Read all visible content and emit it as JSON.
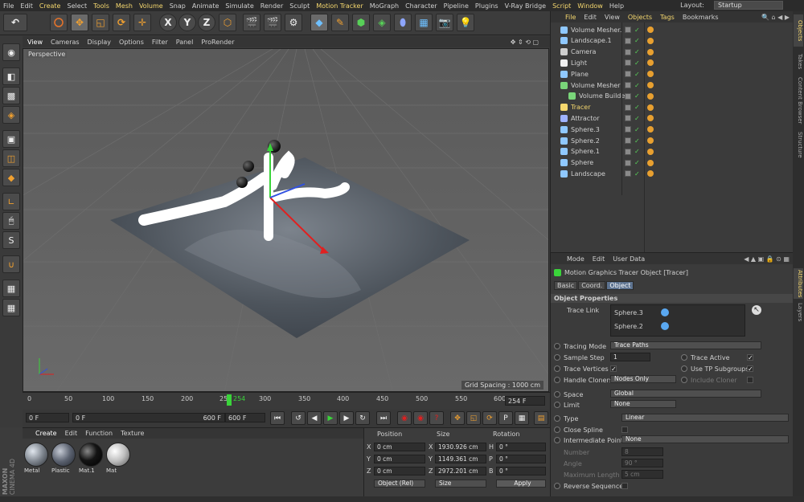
{
  "menu": {
    "items": [
      "File",
      "Edit",
      "Create",
      "Select",
      "Tools",
      "Mesh",
      "Volume",
      "Snap",
      "Animate",
      "Simulate",
      "Render",
      "Sculpt",
      "Motion Tracker",
      "MoGraph",
      "Character",
      "Pipeline",
      "Plugins",
      "V-Ray Bridge",
      "Script",
      "Window",
      "Help"
    ],
    "layout_label": "Layout:",
    "layout_value": "Startup"
  },
  "toolbar": {
    "axis_x": "X",
    "axis_y": "Y",
    "axis_z": "Z"
  },
  "viewport": {
    "menu": [
      "View",
      "Cameras",
      "Display",
      "Options",
      "Filter",
      "Panel",
      "ProRender"
    ],
    "camera_label": "Perspective",
    "grid_spacing": "Grid Spacing : 1000 cm"
  },
  "timeline": {
    "ticks": [
      "0",
      "50",
      "100",
      "150",
      "200",
      "25",
      "254",
      "300",
      "350",
      "400",
      "450",
      "500",
      "550",
      "600"
    ],
    "current_frame": "254",
    "end_frame_display": "254 F"
  },
  "transport": {
    "start": "0 F",
    "range_start": "0 F",
    "range_end": "600 F",
    "end": "600 F"
  },
  "materials": {
    "menu": [
      "Create",
      "Edit",
      "Function",
      "Texture"
    ],
    "items": [
      {
        "name": "Metal",
        "color": "#7f868f"
      },
      {
        "name": "Plastic",
        "color": "#5b6270"
      },
      {
        "name": "Mat.1",
        "color": "#141414"
      },
      {
        "name": "Mat",
        "color": "#bdbdbd"
      }
    ],
    "brand_top": "MAXON",
    "brand_bottom": "CINEMA 4D"
  },
  "coordinates": {
    "headers": [
      "Position",
      "Size",
      "Rotation"
    ],
    "rows": [
      {
        "axis": "X",
        "pos": "0 cm",
        "size": "1930.926 cm",
        "rot_label": "H",
        "rot": "0 °"
      },
      {
        "axis": "Y",
        "pos": "0 cm",
        "size": "1149.361 cm",
        "rot_label": "P",
        "rot": "0 °"
      },
      {
        "axis": "Z",
        "pos": "0 cm",
        "size": "2972.201 cm",
        "rot_label": "B",
        "rot": "0 °"
      }
    ],
    "mode_select": "Object (Rel)",
    "size_select": "Size",
    "apply_label": "Apply"
  },
  "objects": {
    "menu": [
      "File",
      "Edit",
      "View",
      "Objects",
      "Tags",
      "Bookmarks"
    ],
    "rows": [
      {
        "name": "Volume Mesher.1",
        "color": "#8fc8ff",
        "indent": 0
      },
      {
        "name": "Landscape.1",
        "color": "#8fc8ff",
        "indent": 0
      },
      {
        "name": "Camera",
        "color": "#cfcfcf",
        "indent": 0
      },
      {
        "name": "Light",
        "color": "#f0f0f0",
        "indent": 0
      },
      {
        "name": "Plane",
        "color": "#8fc8ff",
        "indent": 0
      },
      {
        "name": "Volume Mesher",
        "color": "#7ad67a",
        "indent": 0
      },
      {
        "name": "Volume Builder",
        "color": "#7ad67a",
        "indent": 1
      },
      {
        "name": "Tracer",
        "color": "#f5d76e",
        "indent": 0
      },
      {
        "name": "Attractor",
        "color": "#9fb3ff",
        "indent": 0
      },
      {
        "name": "Sphere.3",
        "color": "#8fc8ff",
        "indent": 0
      },
      {
        "name": "Sphere.2",
        "color": "#8fc8ff",
        "indent": 0
      },
      {
        "name": "Sphere.1",
        "color": "#8fc8ff",
        "indent": 0
      },
      {
        "name": "Sphere",
        "color": "#8fc8ff",
        "indent": 0
      },
      {
        "name": "Landscape",
        "color": "#8fc8ff",
        "indent": 0
      }
    ]
  },
  "side_tabs": [
    "Objects",
    "Takes",
    "Content Browser",
    "Structure",
    "Attributes",
    "Layers"
  ],
  "attributes": {
    "menu": [
      "Mode",
      "Edit",
      "User Data"
    ],
    "object_title": "Motion Graphics Tracer Object [Tracer]",
    "tabs": [
      "Basic",
      "Coord.",
      "Object"
    ],
    "section": "Object Properties",
    "trace_link_label": "Trace Link",
    "trace_link_items": [
      "Sphere.3",
      "Sphere.2"
    ],
    "tracing_mode_label": "Tracing Mode",
    "tracing_mode_value": "Trace Paths",
    "sample_step_label": "Sample Step",
    "sample_step_value": "1",
    "trace_active_label": "Trace Active",
    "trace_vertices_label": "Trace Vertices",
    "use_tp_label": "Use TP Subgroups",
    "handle_cloners_label": "Handle Cloners",
    "handle_cloners_value": "Nodes Only",
    "include_cloner_label": "Include Cloner",
    "space_label": "Space",
    "space_value": "Global",
    "limit_label": "Limit",
    "limit_value": "None",
    "type_label": "Type",
    "type_value": "Linear",
    "close_spline_label": "Close Spline",
    "intermediate_label": "Intermediate Points",
    "intermediate_value": "None",
    "number_label": "Number",
    "number_value": "8",
    "angle_label": "Angle",
    "angle_value": "90 °",
    "maxlen_label": "Maximum Length",
    "maxlen_value": "5 cm",
    "reverse_label": "Reverse Sequence"
  }
}
